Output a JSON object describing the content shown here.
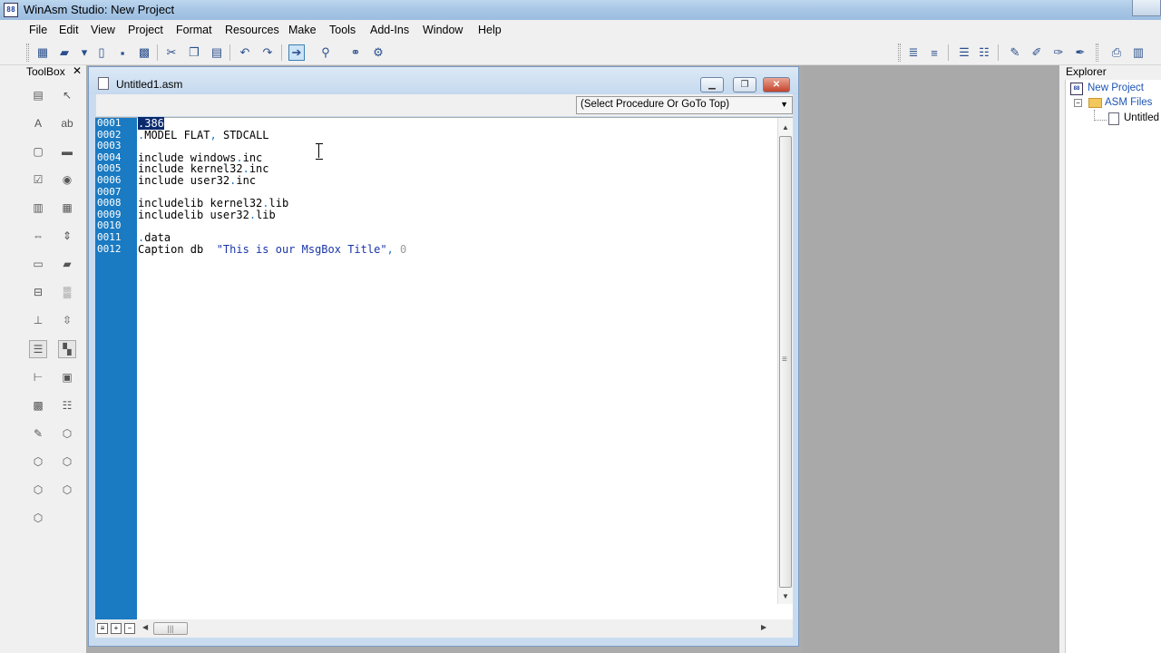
{
  "window": {
    "title": "WinAsm Studio: New Project"
  },
  "menu": [
    "File",
    "Edit",
    "View",
    "Project",
    "Format",
    "Resources",
    "Make",
    "Tools",
    "Add-Ins",
    "Window",
    "Help"
  ],
  "toolbox": {
    "title": "ToolBox",
    "close_glyph": "✕"
  },
  "editor": {
    "tab_title": "Untitled1.asm",
    "procedure_select": "(Select Procedure Or GoTo Top)",
    "line_numbers": [
      "0001",
      "0002",
      "0003",
      "0004",
      "0005",
      "0006",
      "0007",
      "0008",
      "0009",
      "0010",
      "0011",
      "0012"
    ],
    "lines": [
      ".386",
      ".MODEL FLAT, STDCALL",
      "",
      "include windows.inc",
      "include kernel32.inc",
      "include user32.inc",
      "",
      "includelib kernel32.lib",
      "includelib user32.lib",
      "",
      ".data",
      "Caption db  \"This is our MsgBox Title\", 0"
    ]
  },
  "explorer": {
    "title": "Explorer",
    "project": "New Project",
    "folder": "ASM Files",
    "file": "Untitled"
  },
  "colors": {
    "gutter": "#1a7ac2",
    "string": "#1a35a8",
    "selection": "#0b2a6e",
    "mdi_background": "#ababab"
  }
}
